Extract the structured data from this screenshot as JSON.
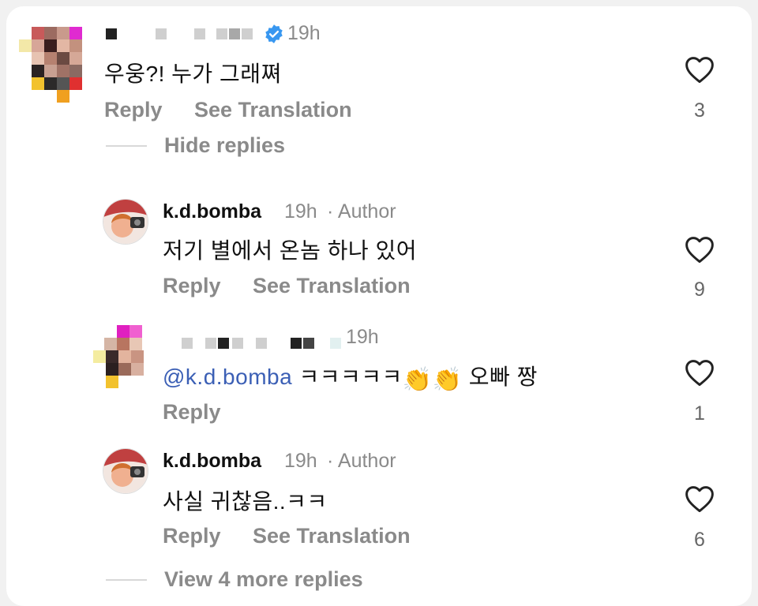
{
  "comments": [
    {
      "time": "19h",
      "text": "우웅?! 누가 그래쪄",
      "reply_label": "Reply",
      "translate_label": "See Translation",
      "likes": "3",
      "hide_replies_label": "Hide replies"
    },
    {
      "username": "k.d.bomba",
      "time": "19h",
      "author_tag": "· Author",
      "text": "저기 별에서 온놈 하나 있어",
      "reply_label": "Reply",
      "translate_label": "See Translation",
      "likes": "9"
    },
    {
      "time": "19h",
      "mention": "@k.d.bomba",
      "text_a": "ㅋㅋㅋㅋㅋ",
      "text_b": "오빠 짱",
      "reply_label": "Reply",
      "likes": "1"
    },
    {
      "username": "k.d.bomba",
      "time": "19h",
      "author_tag": "· Author",
      "text": "사실 귀찮음..ㅋㅋ",
      "reply_label": "Reply",
      "translate_label": "See Translation",
      "likes": "6"
    }
  ],
  "more_replies_label": "View 4 more replies",
  "icons": {
    "heart": "heart-outline-icon",
    "verified": "verified-badge-icon",
    "clap": "clapping-hands-emoji"
  },
  "colors": {
    "mention": "#3b5fb5",
    "verified": "#3897f0",
    "muted": "#8a8a8a"
  }
}
